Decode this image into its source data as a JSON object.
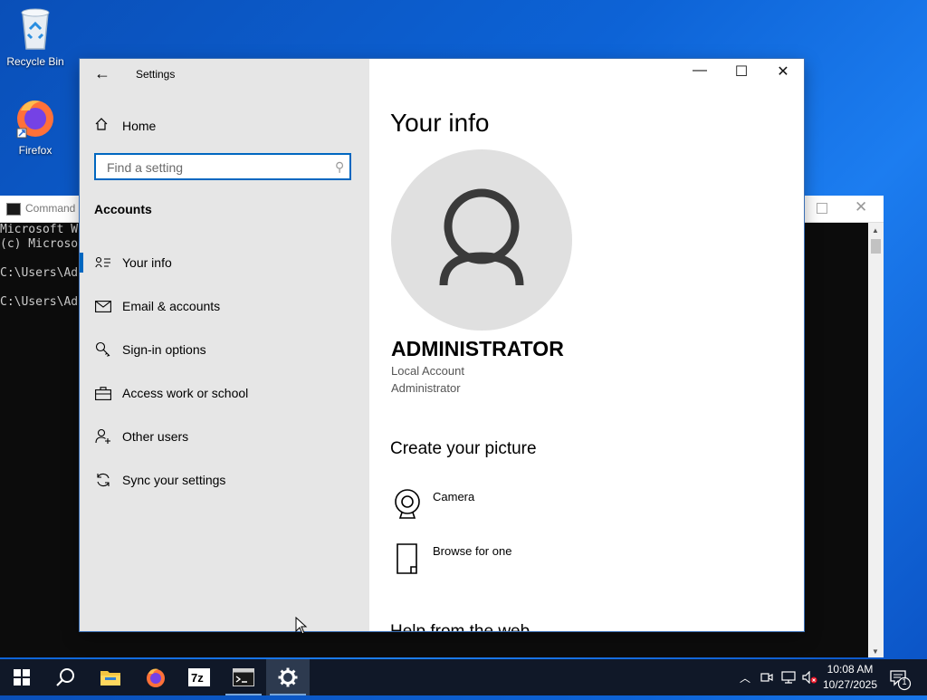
{
  "desktop": {
    "icons": [
      {
        "label": "Recycle Bin"
      },
      {
        "label": "Firefox"
      }
    ]
  },
  "cmd": {
    "title": "Command",
    "lines": [
      "Microsoft W",
      "(c) Microso",
      "",
      "C:\\Users\\Ad",
      "",
      "C:\\Users\\Ad"
    ]
  },
  "settings": {
    "app_title": "Settings",
    "home_label": "Home",
    "search_placeholder": "Find a setting",
    "section_title": "Accounts",
    "nav": [
      {
        "label": "Your info",
        "icon": "contact-card-icon",
        "active": true
      },
      {
        "label": "Email & accounts",
        "icon": "mail-icon",
        "active": false
      },
      {
        "label": "Sign-in options",
        "icon": "key-icon",
        "active": false
      },
      {
        "label": "Access work or school",
        "icon": "briefcase-icon",
        "active": false
      },
      {
        "label": "Other users",
        "icon": "add-user-icon",
        "active": false
      },
      {
        "label": "Sync your settings",
        "icon": "sync-icon",
        "active": false
      }
    ],
    "content": {
      "page_title": "Your info",
      "user_name": "ADMINISTRATOR",
      "account_type": "Local Account",
      "account_role": "Administrator",
      "create_picture_title": "Create your picture",
      "camera_label": "Camera",
      "browse_label": "Browse for one",
      "next_heading": "Help from the web"
    }
  },
  "taskbar": {
    "time": "10:08 AM",
    "date": "10/27/2025",
    "notification_count": "1",
    "pinned": [
      "start-icon",
      "search-icon",
      "file-explorer-icon",
      "firefox-icon",
      "7zip-icon",
      "command-prompt-icon",
      "settings-gear-icon"
    ]
  },
  "colors": {
    "accent": "#0067c0",
    "sidebar_bg": "#e6e6e6",
    "taskbar_bg": "#101828"
  }
}
